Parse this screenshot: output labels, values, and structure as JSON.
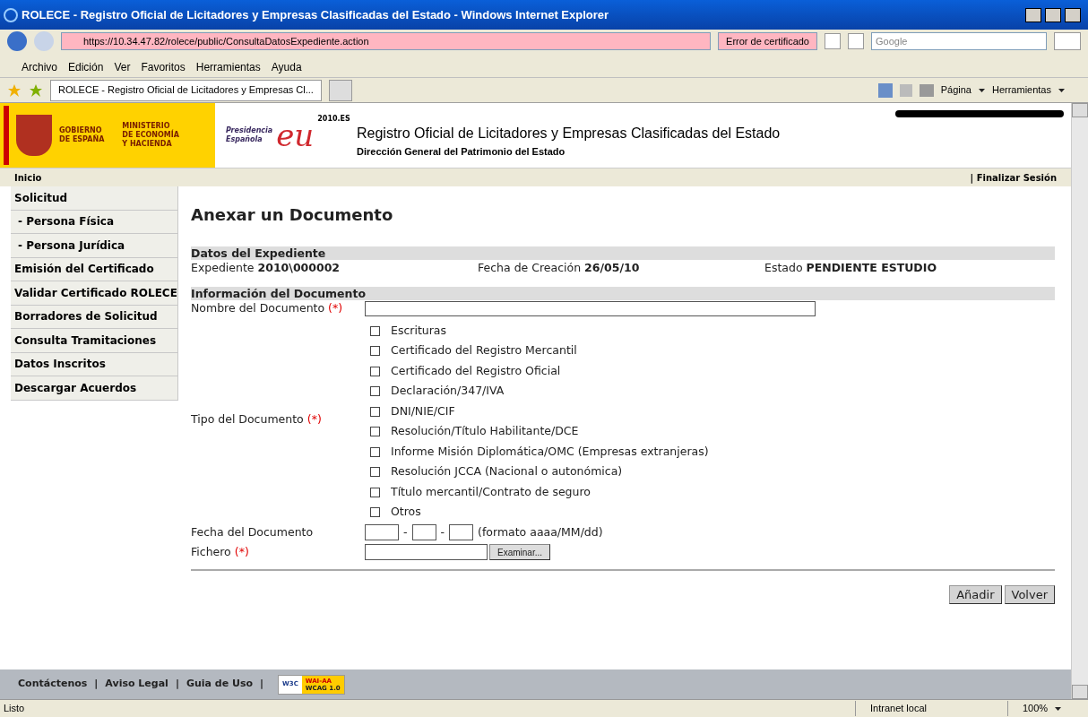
{
  "window": {
    "title": "ROLECE - Registro Oficial de Licitadores y Empresas Clasificadas del Estado - Windows Internet Explorer"
  },
  "address_bar": {
    "url": "https://10.34.47.82/rolece/public/ConsultaDatosExpediente.action",
    "cert_error": "Error de certificado",
    "search_placeholder": "Google"
  },
  "menu": [
    "Archivo",
    "Edición",
    "Ver",
    "Favoritos",
    "Herramientas",
    "Ayuda"
  ],
  "tab": {
    "label": "ROLECE - Registro Oficial de Licitadores y Empresas Cl...",
    "selected": true
  },
  "command_bar": [
    "Página",
    "Herramientas"
  ],
  "header": {
    "gov_line1": "GOBIERNO",
    "gov_line2": "DE ESPAÑA",
    "ministry": [
      "MINISTERIO",
      "DE ECONOMÍA",
      "Y HACIENDA"
    ],
    "presidency": [
      "Presidencia",
      "Española"
    ],
    "eu_logo": "eu",
    "eu_year": "2010.ES",
    "title": "Registro Oficial de Licitadores y Empresas Clasificadas del Estado",
    "subtitle": "Dirección General del Patrimonio del Estado"
  },
  "nav": {
    "home": "Inicio",
    "logout": "| Finalizar Sesión"
  },
  "sidebar": {
    "items": [
      {
        "label": "Solicitud",
        "sub": false
      },
      {
        "label": "- Persona Física",
        "sub": true
      },
      {
        "label": "- Persona Jurídica",
        "sub": true
      },
      {
        "label": "Emisión del Certificado",
        "sub": false
      },
      {
        "label": "Validar Certificado ROLECE",
        "sub": false
      },
      {
        "label": "Borradores de Solicitud",
        "sub": false
      },
      {
        "label": "Consulta Tramitaciones",
        "sub": false
      },
      {
        "label": "Datos Inscritos",
        "sub": false
      },
      {
        "label": "Descargar Acuerdos",
        "sub": false
      }
    ]
  },
  "page_title": "Anexar un Documento",
  "expediente_section": {
    "heading": "Datos del Expediente",
    "fields": [
      {
        "label": "Expediente",
        "value": "2010\\000002"
      },
      {
        "label": "Fecha de Creación",
        "value": "26/05/10"
      },
      {
        "label": "Estado",
        "value": "PENDIENTE ESTUDIO"
      }
    ]
  },
  "document_section": {
    "heading": "Información del Documento",
    "required_mark": "(*)",
    "name_label": "Nombre del Documento",
    "type_label": "Tipo del Documento",
    "date_label": "Fecha del Documento",
    "date_separator": "-",
    "date_hint": "(formato aaaa/MM/dd)",
    "file_label": "Fichero",
    "browse_button": "Examinar...",
    "types": [
      {
        "label": "Escrituras",
        "checked": false
      },
      {
        "label": "Certificado del Registro Mercantil",
        "checked": false
      },
      {
        "label": "Certificado del Registro Oficial",
        "checked": false
      },
      {
        "label": "Declaración/347/IVA",
        "checked": false
      },
      {
        "label": "DNI/NIE/CIF",
        "checked": false
      },
      {
        "label": "Resolución/Título Habilitante/DCE",
        "checked": false
      },
      {
        "label": "Informe Misión Diplomática/OMC (Empresas extranjeras)",
        "checked": false
      },
      {
        "label": "Resolución JCCA (Nacional o autonómica)",
        "checked": false
      },
      {
        "label": "Título mercantil/Contrato de seguro",
        "checked": false
      },
      {
        "label": "Otros",
        "checked": false
      }
    ]
  },
  "buttons": [
    "Añadir",
    "Volver"
  ],
  "footer": {
    "links": [
      "Contáctenos",
      "Aviso Legal",
      "Guia de Uso"
    ],
    "separator": "|",
    "badge_left": "W3C",
    "badge_top": "WAI-AA",
    "badge_bottom": "WCAG 1.0"
  },
  "status_bar": {
    "text": "Listo",
    "zone": "Intranet local",
    "zoom": "100%"
  }
}
